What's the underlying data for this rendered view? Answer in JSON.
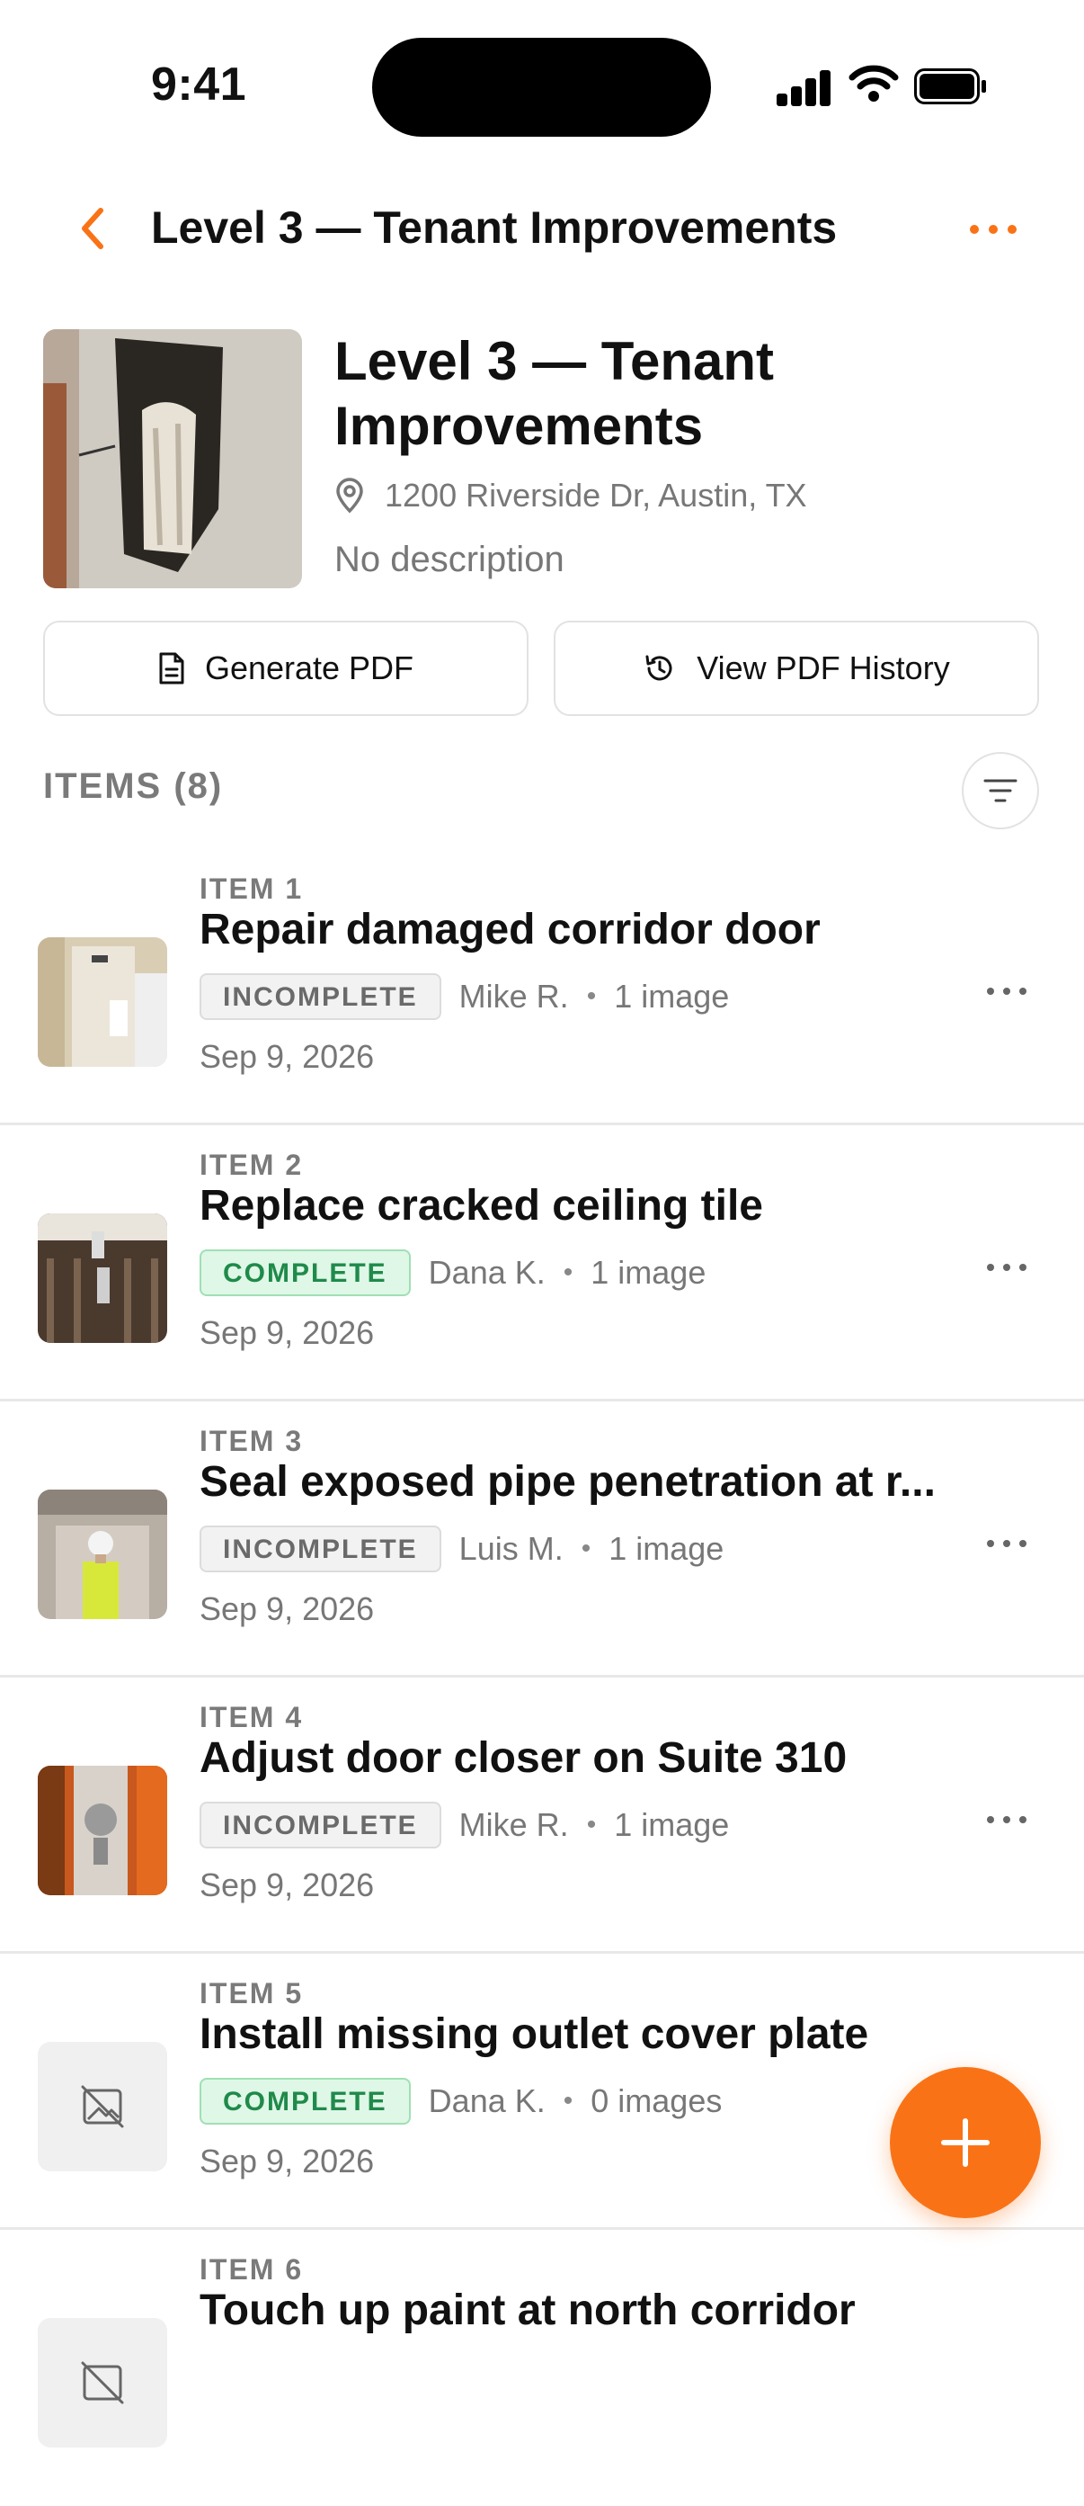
{
  "status_bar": {
    "time": "9:41"
  },
  "nav": {
    "title": "Level 3 — Tenant Improvements"
  },
  "project": {
    "title": "Level 3 — Tenant Improvements",
    "address": "1200 Riverside Dr, Austin, TX",
    "description": "No description"
  },
  "actions": {
    "generate_pdf": "Generate PDF",
    "view_history": "View PDF History"
  },
  "items_header": "ITEMS (8)",
  "items": [
    {
      "num": "ITEM 1",
      "title": "Repair damaged corridor door",
      "status": "INCOMPLETE",
      "assignee": "Mike R.",
      "images": "1 image",
      "date": "Sep 9, 2026"
    },
    {
      "num": "ITEM 2",
      "title": "Replace cracked ceiling tile",
      "status": "COMPLETE",
      "assignee": "Dana K.",
      "images": "1 image",
      "date": "Sep 9, 2026"
    },
    {
      "num": "ITEM 3",
      "title": "Seal exposed pipe penetration at r...",
      "status": "INCOMPLETE",
      "assignee": "Luis M.",
      "images": "1 image",
      "date": "Sep 9, 2026"
    },
    {
      "num": "ITEM 4",
      "title": "Adjust door closer on Suite 310",
      "status": "INCOMPLETE",
      "assignee": "Mike R.",
      "images": "1 image",
      "date": "Sep 9, 2026"
    },
    {
      "num": "ITEM 5",
      "title": "Install missing outlet cover plate",
      "status": "COMPLETE",
      "assignee": "Dana K.",
      "images": "0 images",
      "date": "Sep 9, 2026"
    },
    {
      "num": "ITEM 6",
      "title": "Touch up paint at north corridor"
    }
  ],
  "colors": {
    "accent": "#f97316",
    "complete": "#1f8a4a",
    "complete_bg": "#dff7e7"
  }
}
